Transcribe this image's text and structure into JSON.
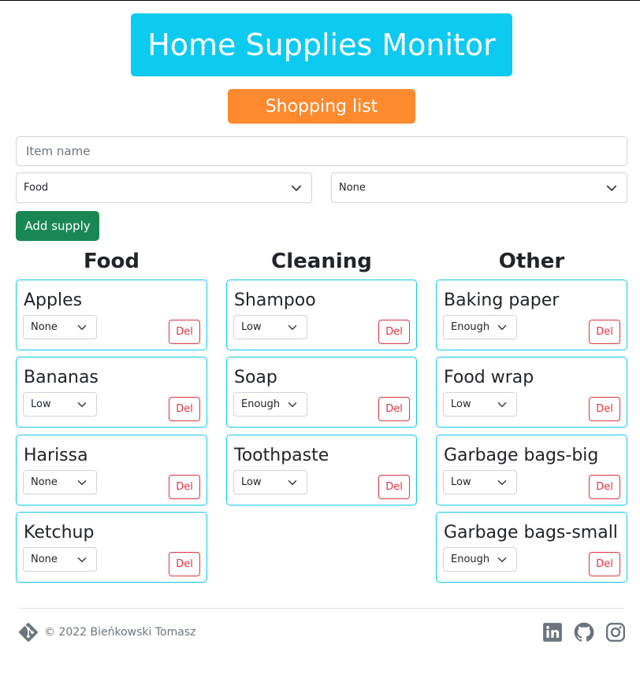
{
  "header": {
    "title": "Home Supplies Monitor"
  },
  "shopping_button": {
    "label": "Shopping list"
  },
  "form": {
    "item_placeholder": "Item name",
    "category_select": "Food",
    "level_select": "None",
    "add_label": "Add supply"
  },
  "columns": [
    {
      "title": "Food",
      "items": [
        {
          "name": "Apples",
          "level": "None"
        },
        {
          "name": "Bananas",
          "level": "Low"
        },
        {
          "name": "Harissa",
          "level": "None"
        },
        {
          "name": "Ketchup",
          "level": "None"
        }
      ]
    },
    {
      "title": "Cleaning",
      "items": [
        {
          "name": "Shampoo",
          "level": "Low"
        },
        {
          "name": "Soap",
          "level": "Enough"
        },
        {
          "name": "Toothpaste",
          "level": "Low"
        }
      ]
    },
    {
      "title": "Other",
      "items": [
        {
          "name": "Baking paper",
          "level": "Enough"
        },
        {
          "name": "Food wrap",
          "level": "Low"
        },
        {
          "name": "Garbage bags-big",
          "level": "Low"
        },
        {
          "name": "Garbage bags-small",
          "level": "Enough"
        }
      ]
    }
  ],
  "del_label": "Del",
  "footer": {
    "copyright": "© 2022 Bieńkowski Tomasz",
    "icons": [
      "git-icon",
      "linkedin-icon",
      "github-icon",
      "instagram-icon"
    ]
  },
  "colors": {
    "title_bg": "#0dcaf0",
    "shopping_bg": "#fd8a2e",
    "add_bg": "#198754",
    "card_border": "#0dcaf0",
    "del_color": "#dc3545"
  }
}
